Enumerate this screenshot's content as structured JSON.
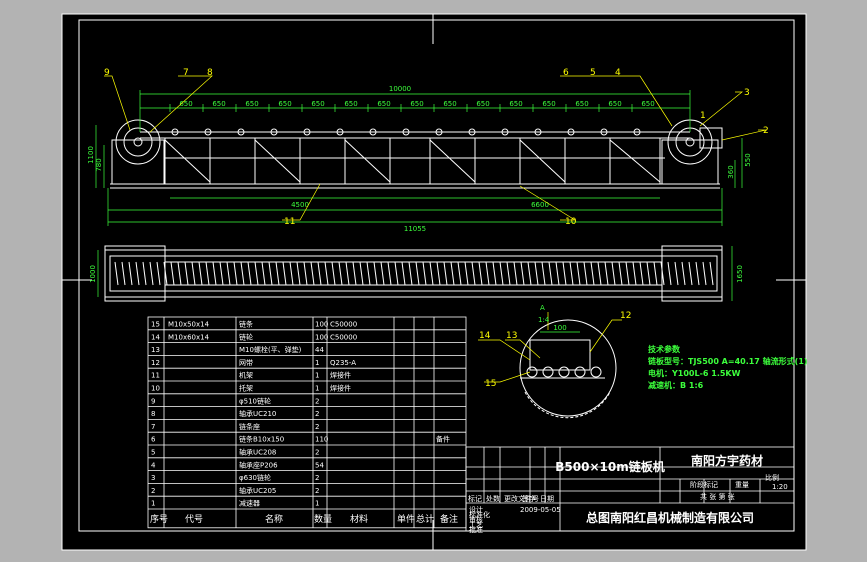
{
  "drawing": {
    "title_main": "B500×10m链板机",
    "title_project": "南阳方宇药材",
    "company": "总图南阳红昌机械制造有限公司",
    "scale": "1:20",
    "colors": {
      "frame": "#ffffff",
      "geometry": "#ffffff",
      "dimension": "#3cff3c",
      "callout": "#ffff00",
      "background": "#000000"
    },
    "callouts_top": [
      "9",
      "7",
      "8",
      "6",
      "5",
      "4",
      "3",
      "1",
      "2"
    ],
    "callouts_bottom": [
      "11",
      "10"
    ],
    "dims_top": {
      "overall": "10000",
      "spans": [
        "650",
        "650",
        "650",
        "650",
        "650",
        "650",
        "650",
        "650",
        "650",
        "650",
        "650",
        "650",
        "650",
        "650",
        "650"
      ]
    },
    "dims_bottom": {
      "length_total": "11055",
      "span_a": "4500",
      "span_b": "6600"
    },
    "dims_left": [
      "1100",
      "780"
    ],
    "dims_right": [
      "550",
      "360"
    ],
    "dims_plan": {
      "width": "1000",
      "side": "1650"
    }
  },
  "detail": {
    "callouts": [
      "14",
      "13",
      "15",
      "12"
    ],
    "label_dim": "100",
    "label_a": "A",
    "label_scale": "1:4"
  },
  "tech_specs": {
    "heading": "技术参数",
    "lines": [
      "链板型号：TJS500 A=40.17 轴流形式(1)",
      "电机：Y100L-6 1.5KW",
      "减速机：B 1:6"
    ]
  },
  "bom": {
    "headers": {
      "seq": "序号",
      "code": "代号",
      "name": "名称",
      "qty": "数量",
      "material": "材料",
      "unit_weight": "单件",
      "total_weight": "总计",
      "note": "备注"
    },
    "rows": [
      {
        "seq": "15",
        "code": "M10x50x14",
        "name": "链条",
        "qty": "100",
        "material": "C50000",
        "note": ""
      },
      {
        "seq": "14",
        "code": "M10x60x14",
        "name": "链轮",
        "qty": "100",
        "material": "C50000",
        "note": ""
      },
      {
        "seq": "13",
        "code": "",
        "name": "M10螺栓(平、弹垫)",
        "qty": "44",
        "material": "",
        "note": ""
      },
      {
        "seq": "12",
        "code": "",
        "name": "网带",
        "qty": "1",
        "material": "Q235-A",
        "note": ""
      },
      {
        "seq": "11",
        "code": "",
        "name": "机架",
        "qty": "1",
        "material": "焊接件",
        "note": ""
      },
      {
        "seq": "10",
        "code": "",
        "name": "托架",
        "qty": "1",
        "material": "焊接件",
        "note": ""
      },
      {
        "seq": "9",
        "code": "",
        "name": "φ510链轮",
        "qty": "2",
        "material": "",
        "note": ""
      },
      {
        "seq": "8",
        "code": "",
        "name": "轴承UC210",
        "qty": "2",
        "material": "",
        "note": ""
      },
      {
        "seq": "7",
        "code": "",
        "name": "链条座",
        "qty": "2",
        "material": "",
        "note": ""
      },
      {
        "seq": "6",
        "code": "",
        "name": "链条B10x150",
        "qty": "110",
        "material": "",
        "note": "备件"
      },
      {
        "seq": "5",
        "code": "",
        "name": "轴承UC208",
        "qty": "2",
        "material": "",
        "note": ""
      },
      {
        "seq": "4",
        "code": "",
        "name": "轴承座P206",
        "qty": "54",
        "material": "",
        "note": ""
      },
      {
        "seq": "3",
        "code": "",
        "name": "φ630链轮",
        "qty": "2",
        "material": "",
        "note": ""
      },
      {
        "seq": "2",
        "code": "",
        "name": "轴承UC205",
        "qty": "2",
        "material": "",
        "note": ""
      },
      {
        "seq": "1",
        "code": "",
        "name": "减速器",
        "qty": "1",
        "material": "",
        "note": ""
      }
    ]
  },
  "title_block": {
    "labels": [
      "标记",
      "处数",
      "更改文件号",
      "签字",
      "日期",
      "设计",
      "标准化",
      "审核",
      "工艺",
      "批准"
    ],
    "stage_label": "阶段标记",
    "weight_label": "重量",
    "scale_label": "比例",
    "sheet_label": "共 张 第 张",
    "date": "2009-05-05"
  }
}
